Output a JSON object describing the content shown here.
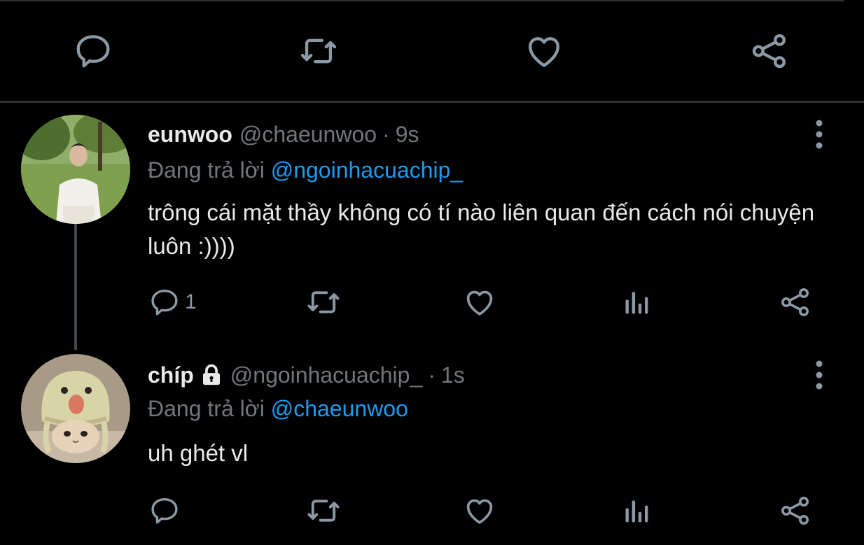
{
  "colors": {
    "background": "#000000",
    "divider": "#2f3336",
    "text_primary": "#e7e9ea",
    "text_secondary": "#71767b",
    "mention": "#1d9bf0",
    "icon": "#8b98a5"
  },
  "top_actions": {
    "icons": [
      "reply-icon",
      "retweet-icon",
      "like-icon",
      "share-icon"
    ]
  },
  "tweets": [
    {
      "display_name": "eunwoo",
      "handle": "@chaeunwoo",
      "separator": "·",
      "time": "9s",
      "reply_prefix": "Đang trả lời",
      "reply_to": "@ngoinhacuachip_",
      "text": "trông cái mặt thầy không có tí nào liên quan đến cách nói chuyện luôn :))))",
      "reply_count": "1",
      "avatar": "photo-avatar-man-in-park",
      "icons": [
        "reply-icon",
        "retweet-icon",
        "like-icon",
        "analytics-icon",
        "share-icon",
        "more-icon"
      ]
    },
    {
      "display_name": "chíp",
      "protected": true,
      "handle": "@ngoinhacuachip_",
      "separator": "·",
      "time": "1s",
      "reply_prefix": "Đang trả lời",
      "reply_to": "@chaeunwoo",
      "text": "uh ghét vl",
      "reply_count": "",
      "avatar": "photo-avatar-kitten-in-knit-hat",
      "icons": [
        "reply-icon",
        "retweet-icon",
        "like-icon",
        "analytics-icon",
        "share-icon",
        "more-icon"
      ]
    }
  ]
}
